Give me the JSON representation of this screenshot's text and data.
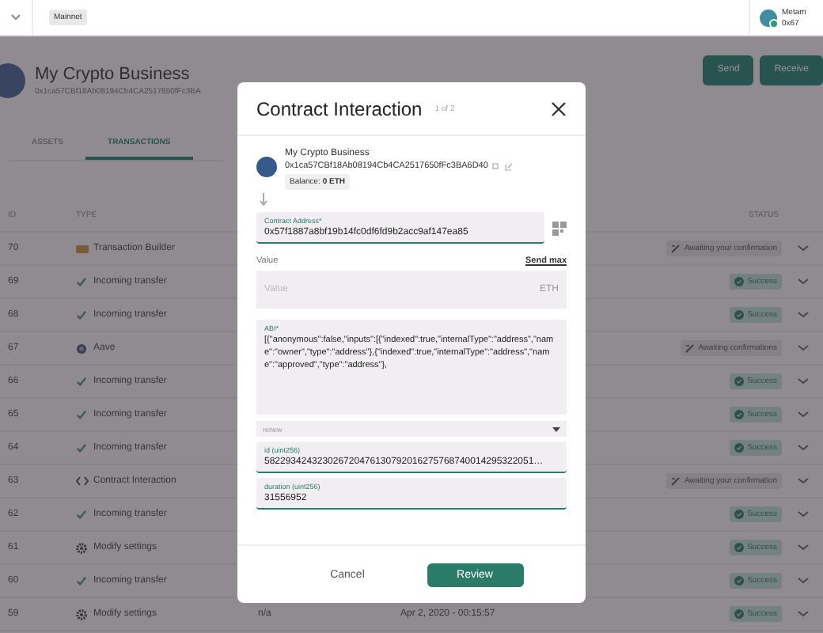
{
  "top_bar": {
    "network": "Mainnet",
    "wallet": {
      "name": "Metam",
      "address": "0x67"
    }
  },
  "safe": {
    "name": "My Crypto Business",
    "address": "0x1ca57CBf18Ab08194Cb4CA2517650fFc3BA",
    "actions": [
      "Send",
      "Receive"
    ]
  },
  "tabs": [
    {
      "label": "ASSETS",
      "selected": false
    },
    {
      "label": "TRANSACTIONS",
      "selected": true
    }
  ],
  "table": {
    "columns": [
      "ID",
      "TYPE",
      "STATUS"
    ],
    "rows": [
      {
        "id": "70",
        "kind": "builder",
        "type": "Transaction Builder",
        "status": {
          "kind": "awaiting",
          "text": "Awaiting your confirmation"
        }
      },
      {
        "id": "69",
        "kind": "incoming",
        "type": "Incoming transfer",
        "status": {
          "kind": "success",
          "text": "Success"
        }
      },
      {
        "id": "68",
        "kind": "incoming",
        "type": "Incoming transfer",
        "status": {
          "kind": "success",
          "text": "Success"
        }
      },
      {
        "id": "67",
        "kind": "app",
        "type": "Aave",
        "status": {
          "kind": "awaiting",
          "text": "Awaiting confirmations"
        }
      },
      {
        "id": "66",
        "kind": "incoming",
        "type": "Incoming transfer",
        "status": {
          "kind": "success",
          "text": "Success"
        }
      },
      {
        "id": "65",
        "kind": "incoming",
        "type": "Incoming transfer",
        "status": {
          "kind": "success",
          "text": "Success"
        }
      },
      {
        "id": "64",
        "kind": "incoming",
        "type": "Incoming transfer",
        "status": {
          "kind": "success",
          "text": "Success"
        }
      },
      {
        "id": "63",
        "kind": "contract",
        "type": "Contract Interaction",
        "status": {
          "kind": "awaiting",
          "text": "Awaiting your confirmation"
        }
      },
      {
        "id": "62",
        "kind": "incoming",
        "type": "Incoming transfer",
        "status": {
          "kind": "success",
          "text": "Success"
        }
      },
      {
        "id": "61",
        "kind": "settings",
        "type": "Modify settings",
        "status": {
          "kind": "success",
          "text": "Success"
        }
      },
      {
        "id": "60",
        "kind": "incoming",
        "type": "Incoming transfer",
        "status": {
          "kind": "success",
          "text": "Success"
        }
      },
      {
        "id": "59",
        "kind": "settings",
        "type": "Modify settings",
        "status": {
          "kind": "success",
          "text": "Success"
        },
        "amount": "n/a",
        "date": "Apr 2, 2020 - 00:15:57"
      }
    ]
  },
  "modal": {
    "title": "Contract Interaction",
    "step": "1 of 2",
    "sender": {
      "name": "My Crypto Business",
      "address": "0x1ca57CBf18Ab08194Cb4CA2517650fFc3BA6D40",
      "balance": "Balance: **0 ETH**"
    },
    "contract_address": {
      "label": "Contract Address*",
      "value": "0x57f1887a8bf19b14fc0df6fd9b2acc9af147ea85"
    },
    "value": {
      "label": "Value",
      "send_max": "Send max",
      "placeholder": "Value",
      "unit": "ETH"
    },
    "abi": {
      "label": "ABI*",
      "value": "[{\"anonymous\":false,\"inputs\":[{\"indexed\":true,\"internalType\":\"address\",\"name\":\"owner\",\"type\":\"address\"},{\"indexed\":true,\"internalType\":\"address\",\"name\":\"approved\",\"type\":\"address\"},"
    },
    "method": {
      "value": "renew"
    },
    "params": [
      {
        "label": "id (uint256)",
        "value": "582293424323026720476130792016275768740014295322051…"
      },
      {
        "label": "duration (uint256)",
        "value": "31556952"
      }
    ],
    "buttons": [
      "Cancel",
      "Review"
    ]
  }
}
